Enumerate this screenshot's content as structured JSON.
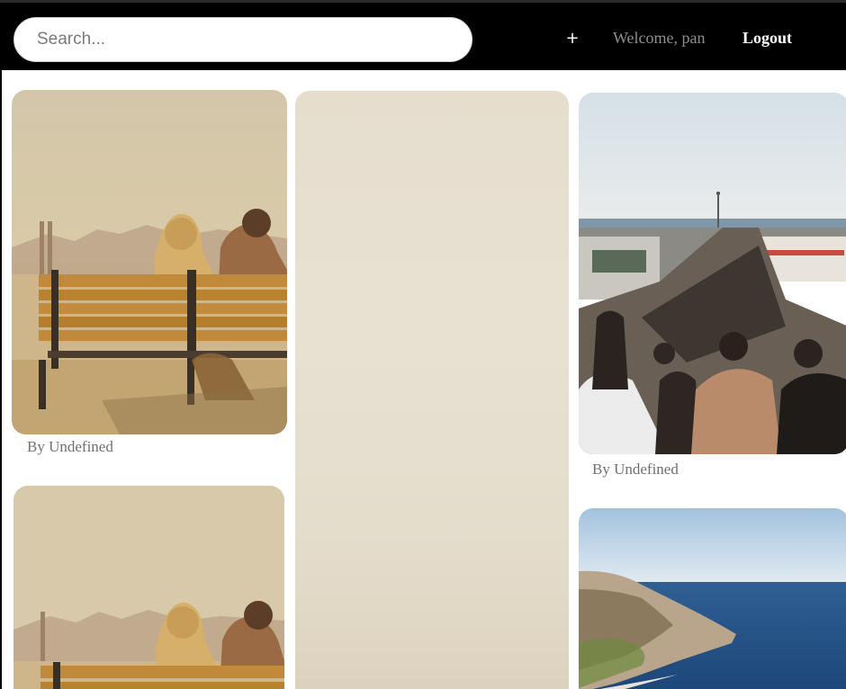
{
  "header": {
    "search_placeholder": "Search...",
    "add_label": "+",
    "welcome_text": "Welcome, pan",
    "logout_label": "Logout"
  },
  "pins": [
    {
      "caption": "By Undefined",
      "photo": "couple on bench facing bay"
    },
    {
      "caption": "",
      "photo": "plain beige"
    },
    {
      "caption": "By Undefined",
      "photo": "crowded pier"
    },
    {
      "caption": "",
      "photo": "couple on bench facing bay"
    },
    {
      "caption": "",
      "photo": "sea cliff"
    }
  ],
  "colors": {
    "header_bg": "#000000",
    "content_bg": "#ffffff",
    "caption_text": "#6f6f6f",
    "welcome_text": "#8e8e8e"
  }
}
